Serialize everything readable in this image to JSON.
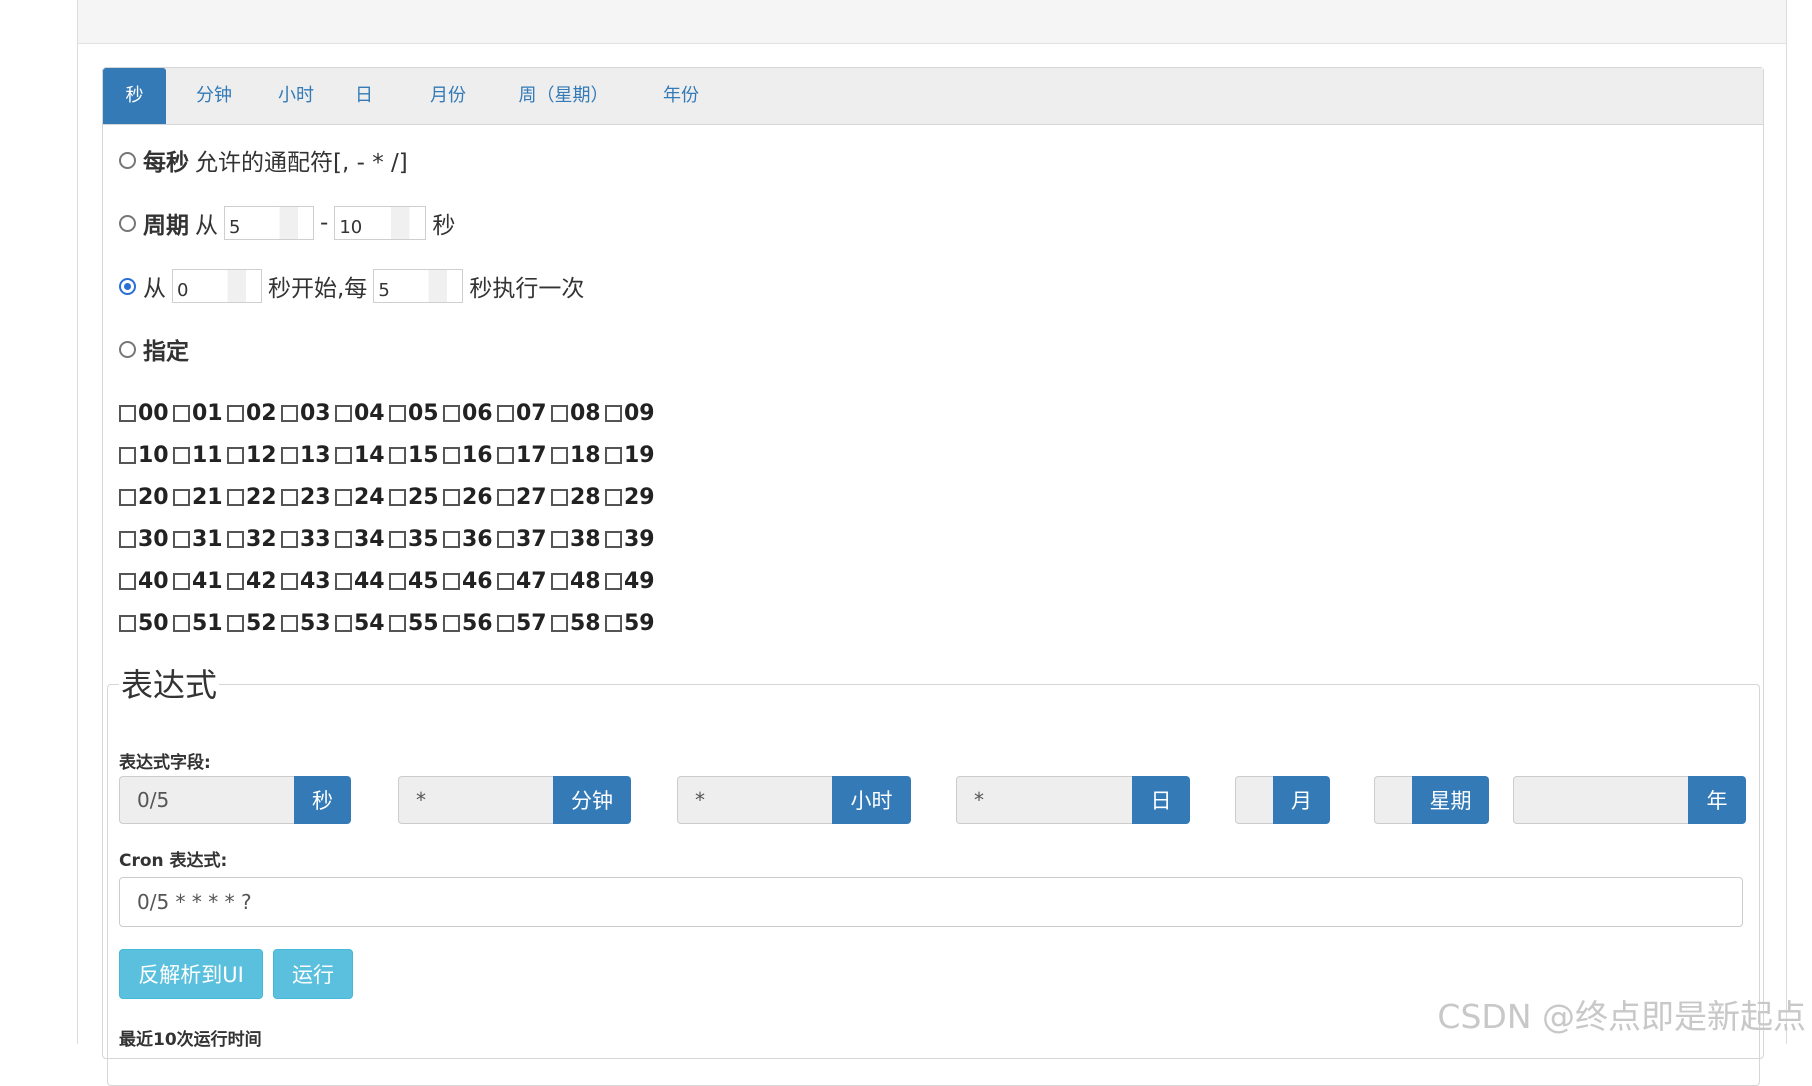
{
  "tabs": [
    "秒",
    "分钟",
    "小时",
    "日",
    "月份",
    "周（星期）",
    "年份"
  ],
  "options": {
    "every": {
      "label": "每秒",
      "desc": "允许的通配符[, - * /]"
    },
    "cycle": {
      "label": "周期",
      "from": "从",
      "start": "5",
      "dash": "-",
      "end": "10",
      "unit": "秒"
    },
    "from_every": {
      "from": "从",
      "start": "0",
      "mid": "秒开始,每",
      "step": "5",
      "tail": "秒执行一次"
    },
    "specify": {
      "label": "指定"
    }
  },
  "seconds": [
    [
      "00",
      "01",
      "02",
      "03",
      "04",
      "05",
      "06",
      "07",
      "08",
      "09"
    ],
    [
      "10",
      "11",
      "12",
      "13",
      "14",
      "15",
      "16",
      "17",
      "18",
      "19"
    ],
    [
      "20",
      "21",
      "22",
      "23",
      "24",
      "25",
      "26",
      "27",
      "28",
      "29"
    ],
    [
      "30",
      "31",
      "32",
      "33",
      "34",
      "35",
      "36",
      "37",
      "38",
      "39"
    ],
    [
      "40",
      "41",
      "42",
      "43",
      "44",
      "45",
      "46",
      "47",
      "48",
      "49"
    ],
    [
      "50",
      "51",
      "52",
      "53",
      "54",
      "55",
      "56",
      "57",
      "58",
      "59"
    ]
  ],
  "expression": {
    "legend": "表达式",
    "fields_label": "表达式字段:",
    "fields": [
      {
        "value": "0/5",
        "unit": "秒"
      },
      {
        "value": "*",
        "unit": "分钟"
      },
      {
        "value": "*",
        "unit": "小时"
      },
      {
        "value": "*",
        "unit": "日"
      },
      {
        "value": "",
        "unit": "月"
      },
      {
        "value": "",
        "unit": "星期"
      },
      {
        "value": "",
        "unit": "年"
      }
    ],
    "cron_label": "Cron 表达式:",
    "cron_value": "0/5 * * * * ?",
    "parse_button": "反解析到UI",
    "run_button": "运行",
    "recent_label": "最近10次运行时间"
  },
  "watermark": "CSDN @终点即是新起点",
  "colors": {
    "primary": "#337ab7",
    "info": "#5bc0de",
    "radio_checked": "#2a6fd6"
  }
}
